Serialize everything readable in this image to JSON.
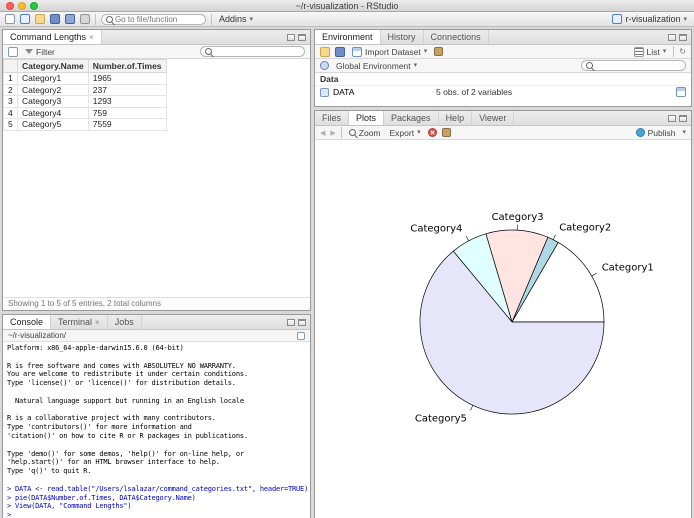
{
  "window": {
    "title": "~/r-visualization - RStudio"
  },
  "icons": {
    "caret_down": "▾",
    "close": "×",
    "refresh": "↻",
    "back": "◀",
    "forward": "▶"
  },
  "main_toolbar": {
    "goto_placeholder": "Go to file/function",
    "addins_label": "Addins",
    "project_label": "r-visualization"
  },
  "viewer": {
    "tab_label": "Command Lengths",
    "filter_label": "Filter",
    "columns": [
      "Category.Name",
      "Number.of.Times"
    ],
    "rows": [
      [
        "1",
        "Category1",
        "1965"
      ],
      [
        "2",
        "Category2",
        "237"
      ],
      [
        "3",
        "Category3",
        "1293"
      ],
      [
        "4",
        "Category4",
        "759"
      ],
      [
        "5",
        "Category5",
        "7559"
      ]
    ],
    "footer": "Showing 1 to 5 of 5 entries, 2 total columns"
  },
  "console": {
    "tabs": [
      "Console",
      "Terminal",
      "Jobs"
    ],
    "path": "~/r-visualization/",
    "command_color": "#0000cc",
    "lines": [
      {
        "c": "out",
        "t": "Platform: x86_64-apple-darwin15.6.0 (64-bit)"
      },
      {
        "c": "out",
        "t": ""
      },
      {
        "c": "out",
        "t": "R is free software and comes with ABSOLUTELY NO WARRANTY."
      },
      {
        "c": "out",
        "t": "You are welcome to redistribute it under certain conditions."
      },
      {
        "c": "out",
        "t": "Type 'license()' or 'licence()' for distribution details."
      },
      {
        "c": "out",
        "t": ""
      },
      {
        "c": "out",
        "t": "  Natural language support but running in an English locale"
      },
      {
        "c": "out",
        "t": ""
      },
      {
        "c": "out",
        "t": "R is a collaborative project with many contributors."
      },
      {
        "c": "out",
        "t": "Type 'contributors()' for more information and"
      },
      {
        "c": "out",
        "t": "'citation()' on how to cite R or R packages in publications."
      },
      {
        "c": "out",
        "t": ""
      },
      {
        "c": "out",
        "t": "Type 'demo()' for some demos, 'help()' for on-line help, or"
      },
      {
        "c": "out",
        "t": "'help.start()' for an HTML browser interface to help."
      },
      {
        "c": "out",
        "t": "Type 'q()' to quit R."
      },
      {
        "c": "out",
        "t": ""
      },
      {
        "c": "in",
        "t": "> DATA <- read.table(\"/Users/lsalazar/command_categories.txt\", header=TRUE)"
      },
      {
        "c": "in",
        "t": "> pie(DATA$Number.of.Times, DATA$Category.Name)"
      },
      {
        "c": "in",
        "t": "> View(DATA, \"Command Lengths\")"
      },
      {
        "c": "in",
        "t": "> "
      }
    ]
  },
  "environment": {
    "tabs": [
      "Environment",
      "History",
      "Connections"
    ],
    "import_dataset_label": "Import Dataset",
    "list_label": "List",
    "scope_label": "Global Environment",
    "section_label": "Data",
    "entries": [
      {
        "name": "DATA",
        "desc": "5 obs. of 2 variables"
      }
    ]
  },
  "plots": {
    "tabs": [
      "Files",
      "Plots",
      "Packages",
      "Help",
      "Viewer"
    ],
    "zoom_label": "Zoom",
    "export_label": "Export",
    "publish_label": "Publish"
  },
  "chart_data": {
    "type": "pie",
    "categories": [
      "Category1",
      "Category2",
      "Category3",
      "Category4",
      "Category5"
    ],
    "values": [
      1965,
      237,
      1293,
      759,
      7559
    ],
    "colors": [
      "#FFFFFF",
      "#ADD8E6",
      "#FFE4E1",
      "#E0FFFF",
      "#E6E6FA"
    ],
    "stroke_color": "#000000",
    "start_angle_deg": 0,
    "direction": "counterclockwise",
    "title": "",
    "legend": "labels-around-slices"
  }
}
